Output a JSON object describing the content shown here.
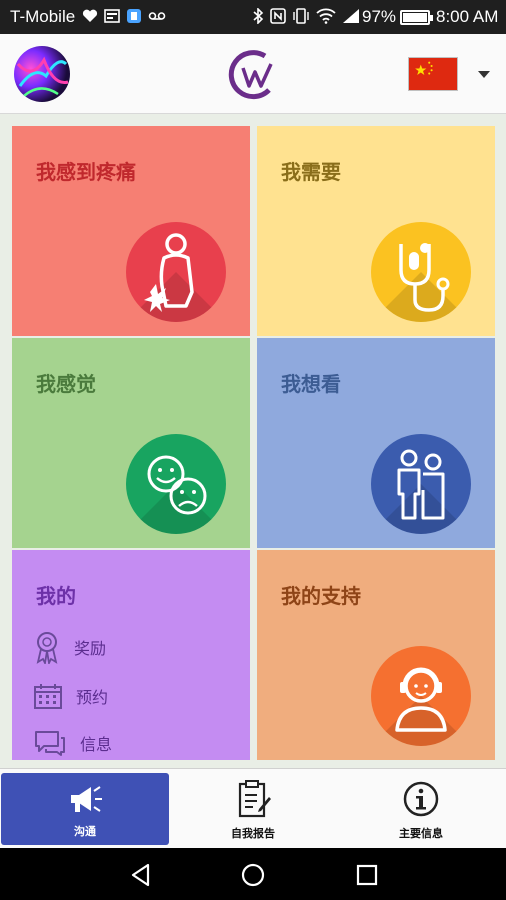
{
  "status_bar": {
    "carrier": "T-Mobile",
    "battery": "97%",
    "time": "8:00 AM"
  },
  "app_bar": {
    "avatar": "avatar-image",
    "logo": "cw-logo",
    "language_flag": "china-flag",
    "dropdown": "chevron-down-icon"
  },
  "tiles": {
    "pain": {
      "title": "我感到疼痛",
      "icon": "back-pain-icon",
      "color": "#f67f73"
    },
    "need": {
      "title": "我需要",
      "icon": "medicine-stethoscope-icon",
      "color": "#ffe290"
    },
    "feel": {
      "title": "我感觉",
      "icon": "happy-sad-faces-icon",
      "color": "#a5d38f"
    },
    "see": {
      "title": "我想看",
      "icon": "doctor-patient-icon",
      "color": "#8fa9dd"
    },
    "mine": {
      "title": "我的",
      "color": "#c48cf2",
      "items": [
        {
          "label": "奖励",
          "icon": "award-ribbon-icon"
        },
        {
          "label": "预约",
          "icon": "calendar-icon"
        },
        {
          "label": "信息",
          "icon": "chat-bubbles-icon"
        }
      ]
    },
    "support": {
      "title": "我的支持",
      "icon": "support-person-headset-icon",
      "color": "#f0ad7e"
    }
  },
  "bottom_nav": [
    {
      "label": "沟通",
      "icon": "megaphone-icon",
      "active": true
    },
    {
      "label": "自我报告",
      "icon": "clipboard-report-icon",
      "active": false
    },
    {
      "label": "主要信息",
      "icon": "info-icon",
      "active": false
    }
  ]
}
